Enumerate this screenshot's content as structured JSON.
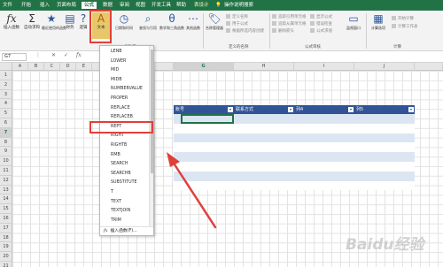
{
  "ribbon_tabs": [
    "文件",
    "开始",
    "插入",
    "页面布局",
    "公式",
    "数据",
    "审阅",
    "视图",
    "开发工具",
    "帮助",
    "表设计",
    "操作说明搜索"
  ],
  "ribbon": {
    "insert_function": "插入函数",
    "autosum": "自动求和",
    "recent": "最近使用的函数",
    "financial": "财务",
    "logical": "逻辑",
    "text": "文本",
    "datetime": "日期和时间",
    "lookup": "查找与引用",
    "math": "数学和三角函数",
    "other": "其他函数",
    "name_manager": "名称管理器",
    "define_name": "定义名称",
    "use_in_formula": "用于公式",
    "create_from_selection": "根据所选内容创建",
    "defined_names_group": "定义的名称",
    "trace_precedents": "追踪引用单元格",
    "trace_dependents": "追踪从属单元格",
    "remove_arrows": "删除箭头",
    "show_formulas": "显示公式",
    "error_checking": "错误检查",
    "evaluate_formula": "公式求值",
    "watch_window": "监视窗口",
    "formula_auditing_group": "公式审核",
    "calc_options": "计算选项",
    "calc_now": "开始计算",
    "calc_sheet": "计算工作表",
    "calculation_group": "计算",
    "function_library_group": "函数库"
  },
  "formula_bar": {
    "name_box": "G7",
    "fx_label": "fx"
  },
  "columns": [
    "A",
    "B",
    "C",
    "D",
    "E",
    "F",
    "G",
    "H",
    "I",
    "J"
  ],
  "rows": [
    "1",
    "2",
    "3",
    "4",
    "5",
    "6",
    "7",
    "8",
    "9",
    "10",
    "11",
    "12",
    "13",
    "14",
    "15",
    "16",
    "17",
    "18",
    "19",
    "20",
    "21"
  ],
  "table_headers": [
    "账号",
    "联系方式",
    "列4",
    "列5"
  ],
  "menu_items": [
    "LENB",
    "LOWER",
    "MID",
    "MIDB",
    "NUMBERVALUE",
    "PROPER",
    "REPLACE",
    "REPLACEB",
    "REPT",
    "RIGHT",
    "RIGHTB",
    "RMB",
    "SEARCH",
    "SEARCHB",
    "SUBSTITUTE",
    "T",
    "TEXT",
    "TEXTJOIN",
    "TRIM"
  ],
  "menu_footer": "插入函数(F)...",
  "watermark": "Baidu经验",
  "colors": {
    "ribbon_green": "#217346",
    "table_header": "#305496",
    "highlight_red": "#e0403a",
    "band_light": "#dce6f2"
  }
}
